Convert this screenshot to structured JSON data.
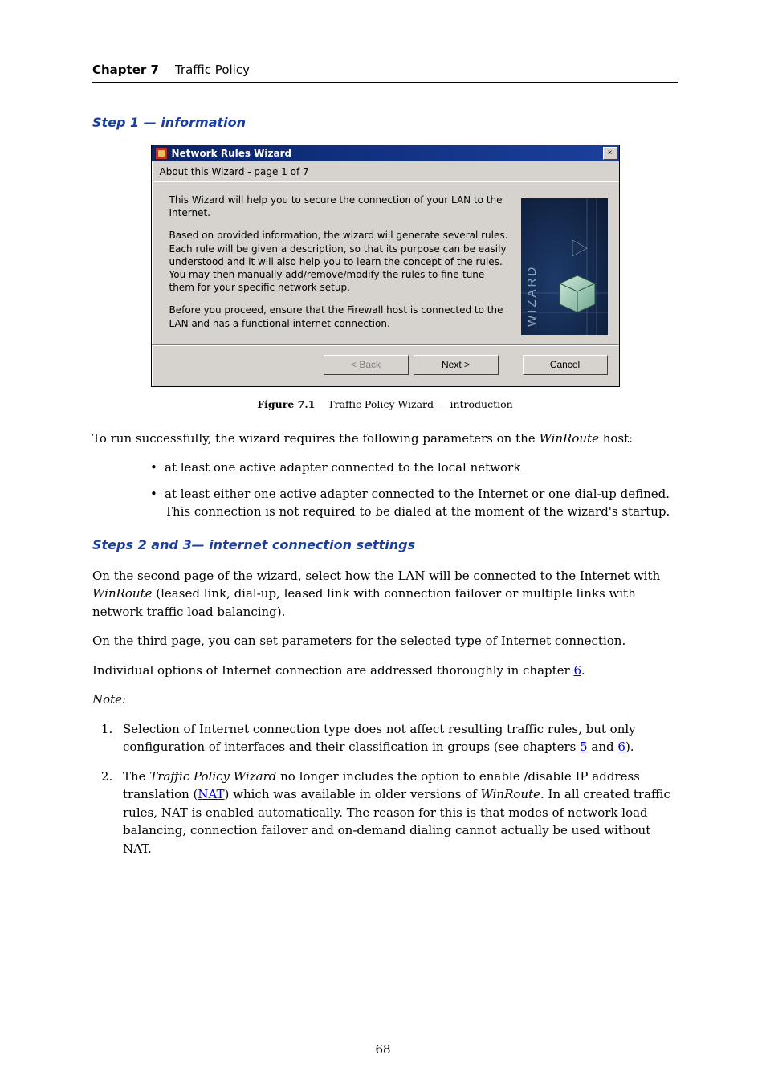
{
  "header": {
    "chapter_label": "Chapter 7",
    "chapter_title": "Traffic Policy"
  },
  "step1": {
    "heading": "Step 1 — information"
  },
  "wizard": {
    "title": "Network Rules Wizard",
    "close_glyph": "×",
    "subtitle": "About this Wizard - page 1 of 7",
    "p1": "This Wizard will help you to secure the connection of your LAN to the Internet.",
    "p2": "Based on provided information, the wizard will generate several rules. Each rule will be given a description, so that its purpose can be easily understood and it will also help you to learn the concept of the rules. You may then manually add/remove/modify the rules to fine-tune them for your specific network setup.",
    "p3": "Before you proceed, ensure that the Firewall host is connected to the LAN and has a functional internet connection.",
    "buttons": {
      "back_prefix": "< ",
      "back_letter": "B",
      "back_rest": "ack",
      "next_letter": "N",
      "next_rest": "ext >",
      "cancel_letter": "C",
      "cancel_rest": "ancel"
    }
  },
  "figure": {
    "label": "Figure 7.1",
    "caption": "Traffic Policy Wizard — introduction"
  },
  "para_intro": {
    "pre": "To run successfully, the wizard requires the following parameters on the ",
    "em": "WinRoute",
    "post": " host:"
  },
  "bullets": {
    "b1": "at least one active adapter connected to the local network",
    "b2": "at least either one active adapter connected to the Internet or one dial-up defined. This connection is not required to be dialed at the moment of the wizard's startup."
  },
  "step23": {
    "heading": "Steps 2 and 3— internet connection settings",
    "p1_pre": "On the second page of the wizard, select how the LAN will be connected to the Internet with ",
    "p1_em": "WinRoute",
    "p1_post": " (leased link, dial-up, leased link with connection failover or multiple links with network traffic load balancing).",
    "p2": "On the third page, you can set parameters for the selected type of Internet connection.",
    "p3_pre": "Individual options of Internet connection are addressed thoroughly in chapter ",
    "p3_link": "6",
    "p3_post": "."
  },
  "note_label": "Note:",
  "notes": {
    "n1_pre": "Selection of Internet connection type does not affect resulting traffic rules, but only configuration of interfaces and their classification in groups (see chapters ",
    "n1_link1": "5",
    "n1_mid": " and ",
    "n1_link2": "6",
    "n1_post": ").",
    "n2_pre": "The ",
    "n2_em1": "Traffic Policy Wizard",
    "n2_mid1": " no longer includes the option to enable /disable IP address translation (",
    "n2_link": "NAT",
    "n2_mid2": ") which was available in older versions of ",
    "n2_em2": "WinRoute",
    "n2_post": ". In all created traffic rules, NAT is enabled automatically. The reason for this is that modes of network load balancing, connection failover and on-demand dialing cannot actually be used without NAT."
  },
  "page_number": "68"
}
